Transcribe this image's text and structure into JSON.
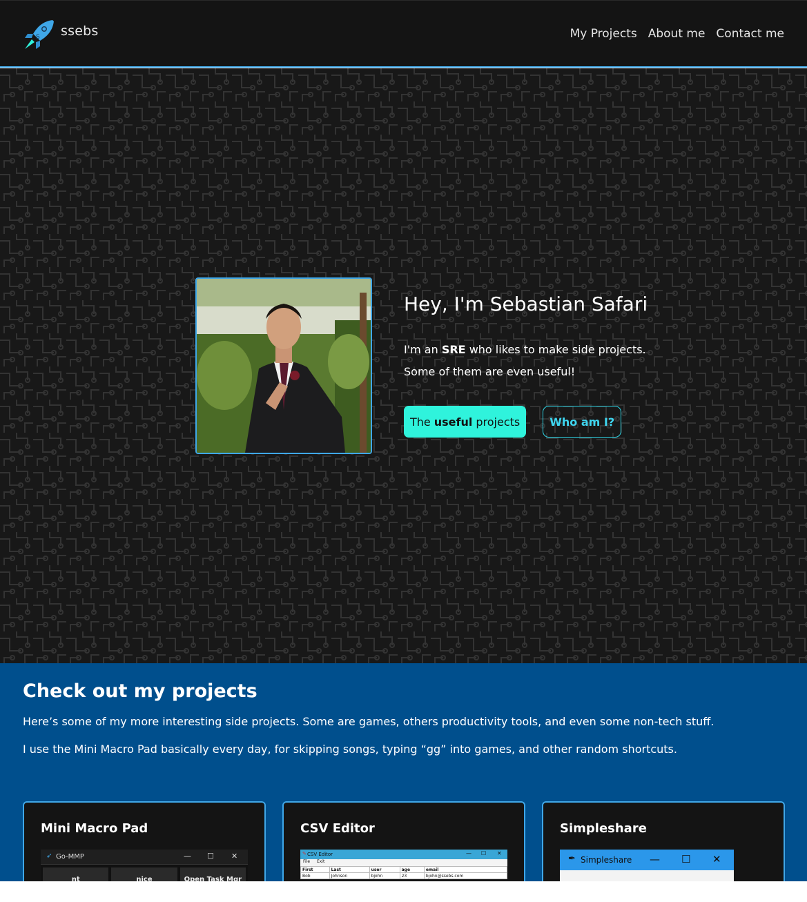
{
  "nav": {
    "brand": "ssebs",
    "links": [
      "My Projects",
      "About me",
      "Contact me"
    ]
  },
  "hero": {
    "title": "Hey, I'm Sebastian Safari",
    "line1_pre": "I'm an ",
    "line1_bold": "SRE",
    "line1_post": " who likes to make side projects.",
    "line2": "Some of them are even useful!",
    "primary_button": {
      "pre": "The",
      "bold": "useful",
      "post": "projects"
    },
    "secondary_button": "Who am I?"
  },
  "projects": {
    "title": "Check out my projects",
    "desc1": "Here’s some of my more interesting side projects. Some are games, others productivity tools, and even some non-tech stuff.",
    "desc2": "I use the Mini Macro Pad basically every day, for skipping songs, typing “gg” into games, and other random shortcuts.",
    "cards": [
      {
        "title": "Mini Macro Pad",
        "window_title": "Go-MMP",
        "keys": [
          "nt",
          "nice",
          "Open Task Mgr"
        ]
      },
      {
        "title": "CSV Editor",
        "window_title": "CSV Editor",
        "menu": [
          "File",
          "Exit"
        ],
        "headers": [
          "First",
          "Last",
          "user",
          "age",
          "email"
        ],
        "row": [
          "Bob",
          "Johnson",
          "bjohn",
          "23",
          "bjohn@ssebs.com"
        ]
      },
      {
        "title": "Simpleshare",
        "window_title": "Simpleshare"
      }
    ]
  },
  "colors": {
    "accent": "#3fa7e8",
    "cta": "#2ff3dc",
    "section_bg": "#004f8d",
    "dark": "#141414"
  },
  "icons": [
    "rocket-logo-icon",
    "minimize-icon",
    "maximize-icon",
    "close-icon"
  ]
}
